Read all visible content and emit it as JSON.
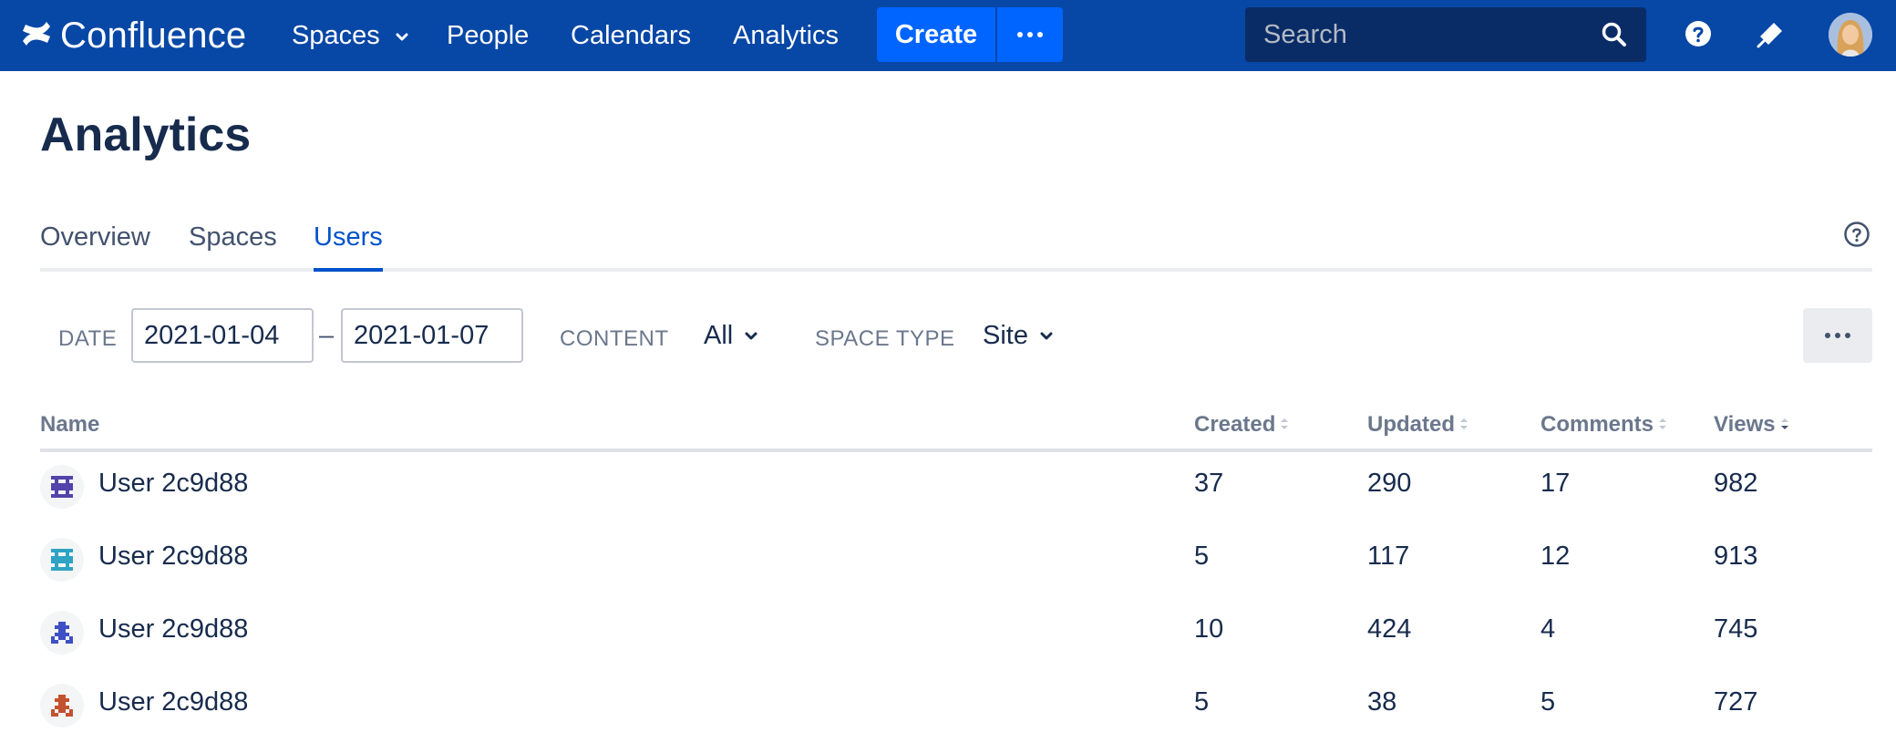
{
  "app": {
    "name": "Confluence"
  },
  "nav": {
    "spaces": "Spaces",
    "people": "People",
    "calendars": "Calendars",
    "analytics": "Analytics",
    "create": "Create",
    "search_placeholder": "Search"
  },
  "icons": {
    "logo": "confluence-logo-icon",
    "search": "search-icon",
    "help": "help-icon",
    "notifications": "notification-icon",
    "more": "more-dots-icon"
  },
  "page": {
    "title": "Analytics"
  },
  "tabs": [
    {
      "label": "Overview",
      "active": false
    },
    {
      "label": "Spaces",
      "active": false
    },
    {
      "label": "Users",
      "active": true
    }
  ],
  "filters": {
    "date_label": "DATE",
    "date_from": "2021-01-04",
    "date_sep": "–",
    "date_to": "2021-01-07",
    "content_label": "CONTENT",
    "content_value": "All",
    "space_type_label": "SPACE TYPE",
    "space_type_value": "Site"
  },
  "table": {
    "headers": {
      "name": "Name",
      "created": "Created",
      "updated": "Updated",
      "comments": "Comments",
      "views": "Views"
    },
    "sorted_by": "Views",
    "rows": [
      {
        "name": "User 2c9d88",
        "created": "37",
        "updated": "290",
        "comments": "17",
        "views": "982",
        "avatar_color": "#5243aa"
      },
      {
        "name": "User 2c9d88",
        "created": "5",
        "updated": "117",
        "comments": "12",
        "views": "913",
        "avatar_color": "#2ea3c4"
      },
      {
        "name": "User 2c9d88",
        "created": "10",
        "updated": "424",
        "comments": "4",
        "views": "745",
        "avatar_color": "#3d4fc4"
      },
      {
        "name": "User 2c9d88",
        "created": "5",
        "updated": "38",
        "comments": "5",
        "views": "727",
        "avatar_color": "#c4512e"
      }
    ]
  },
  "colors": {
    "nav_bg": "#0747a6",
    "create_bg": "#0065ff",
    "active_tab": "#0052cc",
    "text": "#172b4d"
  }
}
